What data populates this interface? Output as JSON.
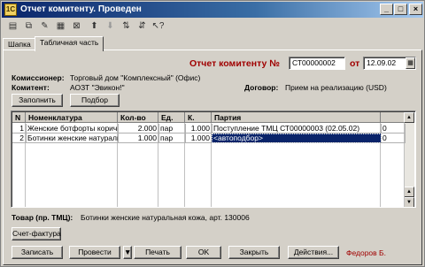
{
  "window": {
    "title": "Отчет комитенту. Проведен",
    "app_icon": "1С",
    "controls": [
      "_",
      "□",
      "×"
    ]
  },
  "toolbar": {
    "tools": [
      {
        "icon": "document-icon",
        "glyph": "▤",
        "disabled": false
      },
      {
        "icon": "copy-icon",
        "glyph": "⧉",
        "disabled": false
      },
      {
        "icon": "edit-icon",
        "glyph": "✎",
        "disabled": false
      },
      {
        "icon": "table-icon",
        "glyph": "▦",
        "disabled": false
      },
      {
        "icon": "delete-icon",
        "glyph": "⊠",
        "disabled": false
      },
      {
        "icon": "arrow-up-icon",
        "glyph": "⬆",
        "disabled": false
      },
      {
        "icon": "arrow-down-icon",
        "glyph": "⬇",
        "disabled": true
      },
      {
        "icon": "sort-asc-icon",
        "glyph": "⇅",
        "disabled": false
      },
      {
        "icon": "sort-desc-icon",
        "glyph": "⇵",
        "disabled": false
      },
      {
        "icon": "help-cursor-icon",
        "glyph": "↖?",
        "disabled": false
      }
    ]
  },
  "tabs": [
    {
      "label": "Шапка",
      "active": false
    },
    {
      "label": "Табличная часть",
      "active": true
    }
  ],
  "header": {
    "doc_title": "Отчет комитенту №",
    "doc_number": "СТ00000002",
    "from_label": "от",
    "doc_date": "12.09.02",
    "commissioner_label": "Комиссионер:",
    "commissioner_value": "Торговый дом \"Комплексный\" (Офис)",
    "committent_label": "Комитент:",
    "committent_value": "АОЗТ \"Эвикон!\"",
    "contract_label": "Договор:",
    "contract_value": "Прием на реализацию (USD)"
  },
  "actions": {
    "fill": "Заполнить",
    "select": "Подбор"
  },
  "table": {
    "columns": [
      "N",
      "Номенклатура",
      "Кол-во",
      "Ед.",
      "К.",
      "Партия",
      ""
    ],
    "rows": [
      [
        "1",
        "Женские ботфорты коричнев",
        "2.000",
        "пар",
        "1.000",
        "Поступление ТМЦ СТ00000003 (02.05.02)",
        "0"
      ],
      [
        "2",
        "Ботинки женские натуральна",
        "1.000",
        "пар",
        "1.000",
        "<автоподбор>",
        "0"
      ]
    ],
    "selected_row": 1
  },
  "footer": {
    "goods_label": "Товар (пр. ТМЦ):",
    "goods_value": "Ботинки женские натуральная кожа, арт. 130006",
    "invoice": "Счет-фактура",
    "write": "Записать",
    "post": "Провести",
    "print": "Печать",
    "ok": "OK",
    "close": "Закрыть",
    "actions": "Действия...",
    "author": "Федоров Б."
  }
}
